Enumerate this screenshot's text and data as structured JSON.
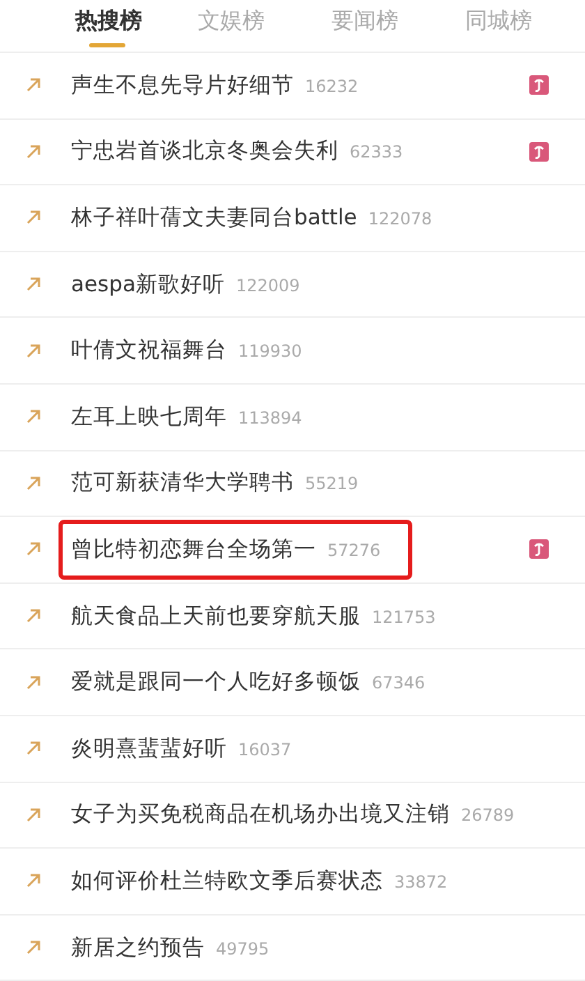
{
  "tabs": [
    {
      "label": "热搜榜",
      "selected": true
    },
    {
      "label": "文娱榜",
      "selected": false
    },
    {
      "label": "要闻榜",
      "selected": false
    },
    {
      "label": "同城榜",
      "selected": false
    }
  ],
  "rows": [
    {
      "title": "声生不息先导片好细节",
      "count": "16232",
      "badge": true,
      "highlighted": false
    },
    {
      "title": "宁忠岩首谈北京冬奥会失利",
      "count": "62333",
      "badge": true,
      "highlighted": false
    },
    {
      "title": "林子祥叶蒨文夫妻同台battle",
      "count": "122078",
      "badge": false,
      "highlighted": false
    },
    {
      "title": "aespa新歌好听",
      "count": "122009",
      "badge": false,
      "highlighted": false
    },
    {
      "title": "叶倩文祝福舞台",
      "count": "119930",
      "badge": false,
      "highlighted": false
    },
    {
      "title": "左耳上映七周年",
      "count": "113894",
      "badge": false,
      "highlighted": false
    },
    {
      "title": "范可新获清华大学聘书",
      "count": "55219",
      "badge": false,
      "highlighted": false
    },
    {
      "title": "曾比特初恋舞台全场第一",
      "count": "57276",
      "badge": true,
      "highlighted": true
    },
    {
      "title": "航天食品上天前也要穿航天服",
      "count": "121753",
      "badge": false,
      "highlighted": false
    },
    {
      "title": "爱就是跟同一个人吃好多顿饭",
      "count": "67346",
      "badge": false,
      "highlighted": false
    },
    {
      "title": "炎明熹蜚蜚好听",
      "count": "16037",
      "badge": false,
      "highlighted": false
    },
    {
      "title": "女子为买免税商品在机场办出境又注销",
      "count": "26789",
      "badge": false,
      "highlighted": false
    },
    {
      "title": "如何评价杜兰特欧文季后赛状态",
      "count": "33872",
      "badge": false,
      "highlighted": false
    },
    {
      "title": "新居之约预告",
      "count": "49795",
      "badge": false,
      "highlighted": false
    }
  ]
}
